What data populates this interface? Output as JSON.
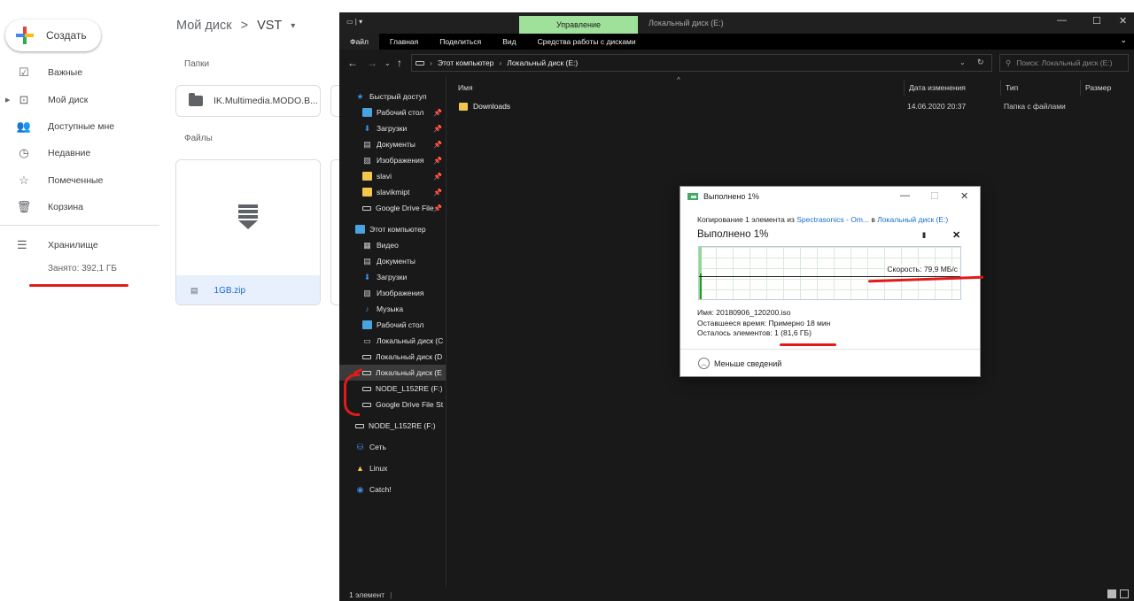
{
  "drive": {
    "create_label": "Создать",
    "nav": [
      {
        "label": "Важные",
        "icon": "priority-icon"
      },
      {
        "label": "Мой диск",
        "icon": "my-drive-icon"
      },
      {
        "label": "Доступные мне",
        "icon": "shared-icon"
      },
      {
        "label": "Недавние",
        "icon": "recent-icon"
      },
      {
        "label": "Помеченные",
        "icon": "star-icon"
      },
      {
        "label": "Корзина",
        "icon": "trash-icon"
      }
    ],
    "storage_label": "Хранилище",
    "storage_used": "Занято: 392,1 ГБ",
    "breadcrumb": {
      "root": "Мой диск",
      "separator": ">",
      "current": "VST",
      "dropdown": "▾"
    },
    "folders_label": "Папки",
    "files_label": "Файлы",
    "folder_name": "IK.Multimedia.MODO.B...",
    "file_name": "1GB.zip"
  },
  "explorer": {
    "manage_tab": "Управление",
    "window_title": "Локальный диск (E:)",
    "ribbon_tabs": [
      "Файл",
      "Главная",
      "Поделиться",
      "Вид",
      "Средства работы с дисками"
    ],
    "address_root": "Этот компьютер",
    "address_current": "Локальный диск (E:)",
    "search_placeholder": "Поиск: Локальный диск (E:)",
    "columns": {
      "name": "Имя",
      "date": "Дата изменения",
      "type": "Тип",
      "size": "Размер"
    },
    "files": [
      {
        "name": "Downloads",
        "date": "14.06.2020 20:37",
        "type": "Папка с файлами"
      }
    ],
    "nav_quick_access": "Быстрый доступ",
    "nav_quick": [
      {
        "label": "Рабочий стол",
        "pin": true
      },
      {
        "label": "Загрузки",
        "pin": true
      },
      {
        "label": "Документы",
        "pin": true
      },
      {
        "label": "Изображения",
        "pin": true
      },
      {
        "label": "slavi",
        "pin": true
      },
      {
        "label": "slavikmipt",
        "pin": true
      },
      {
        "label": "Google Drive File",
        "pin": true
      }
    ],
    "nav_this_pc": "Этот компьютер",
    "nav_pc": [
      {
        "label": "Видео"
      },
      {
        "label": "Документы"
      },
      {
        "label": "Загрузки"
      },
      {
        "label": "Изображения"
      },
      {
        "label": "Музыка"
      },
      {
        "label": "Рабочий стол"
      },
      {
        "label": "Локальный диск (C"
      },
      {
        "label": "Локальный диск (D"
      },
      {
        "label": "Локальный диск (E"
      },
      {
        "label": "NODE_L152RE (F:)"
      },
      {
        "label": "Google Drive File St"
      }
    ],
    "nav_bottom": [
      {
        "label": "NODE_L152RE (F:)"
      },
      {
        "label": "Сеть"
      },
      {
        "label": "Linux"
      },
      {
        "label": "Catch!"
      }
    ],
    "status_text": "1 элемент"
  },
  "dialog": {
    "title": "Выполнено 1%",
    "from_prefix": "Копирование 1 элемента из",
    "from_source": "Spectrasonics - Om...",
    "from_mid": "в",
    "from_dest": "Локальный диск (E:)",
    "heading": "Выполнено 1%",
    "pause": "II",
    "cancel": "✕",
    "speed": "Скорость: 79,9 МБ/с",
    "progress_percent": 1,
    "name_label": "Имя:",
    "name_value": "20180906_120200.iso",
    "time_label": "Оставшееся время:",
    "time_value": "Примерно 18 мин",
    "items_label": "Осталось элементов:",
    "items_value": "1 (81,6 ГБ)",
    "less_details": "Меньше сведений"
  },
  "colors": {
    "annotation_red": "#e21a1a",
    "manage_tab_green": "#9fe19a",
    "progress_green": "#8fdb8f",
    "link_blue": "#1a6fc7"
  }
}
